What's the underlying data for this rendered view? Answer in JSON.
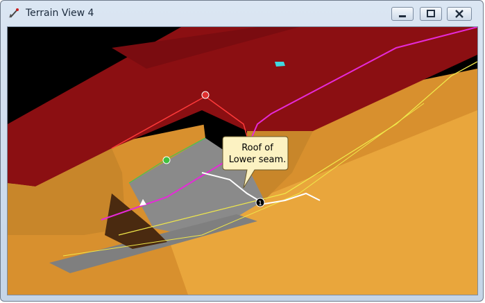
{
  "window": {
    "title": "Terrain View 4",
    "app_icon": "shovel-icon",
    "controls": {
      "minimize": "minimize-icon",
      "maximize": "maximize-icon",
      "close": "close-icon"
    }
  },
  "viewport": {
    "callout": {
      "line1": "Roof of",
      "line2": "Lower seam."
    },
    "markers": [
      {
        "label": "1"
      }
    ],
    "colors": {
      "background": "#000000",
      "overburden": "#8b0f12",
      "terrain": "#e6a23a",
      "seam_floor": "#8a8a8a",
      "boundary_magenta": "#e62ad8",
      "boundary_yellow": "#f0e84a",
      "boundary_green": "#4fc04f",
      "callout_fill": "#fcf2c2"
    }
  }
}
